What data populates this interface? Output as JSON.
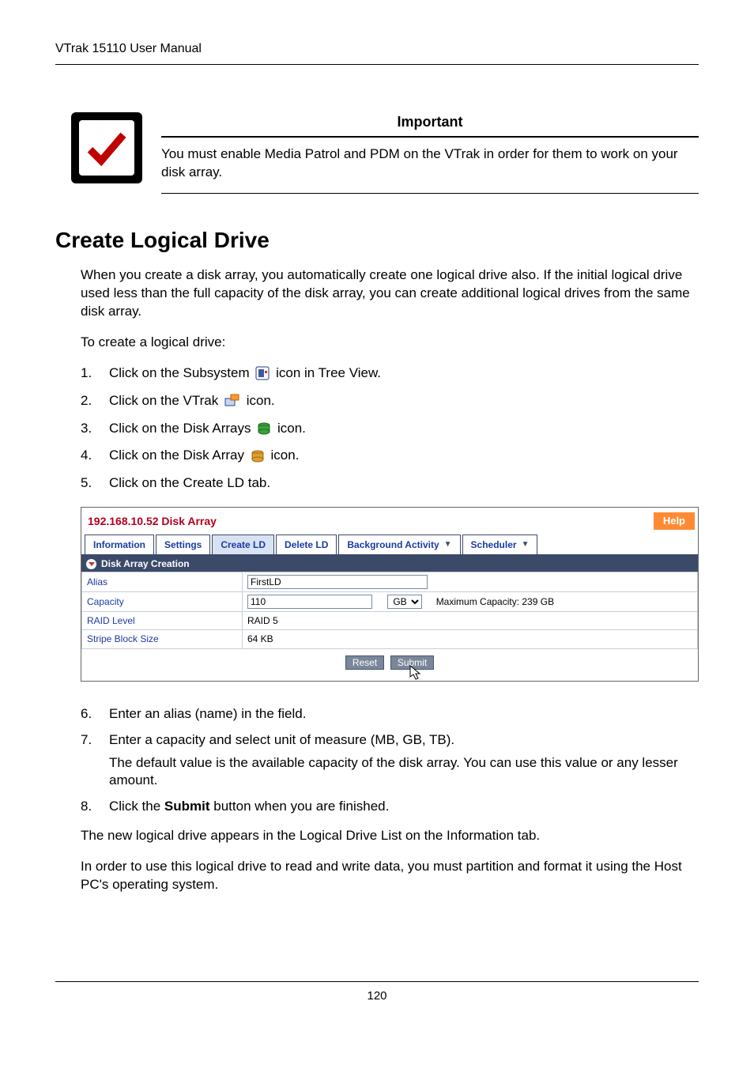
{
  "header": {
    "title": "VTrak 15110 User Manual"
  },
  "important": {
    "heading": "Important",
    "text": "You must enable Media Patrol and PDM on the VTrak in order for them to work on your disk array."
  },
  "section_title": "Create Logical Drive",
  "intro1": "When you create a disk array, you automatically create one logical drive also. If the initial logical drive used less than the full capacity of the disk array, you can create additional logical drives from the same disk array.",
  "intro2": "To create a logical drive:",
  "steps_a": [
    {
      "num": "1.",
      "before": "Click on the Subsystem ",
      "after": " icon in Tree View.",
      "icon": "subsystem"
    },
    {
      "num": "2.",
      "before": "Click on the VTrak ",
      "after": " icon.",
      "icon": "vtrak"
    },
    {
      "num": "3.",
      "before": "Click on the Disk Arrays ",
      "after": " icon.",
      "icon": "disk-arrays"
    },
    {
      "num": "4.",
      "before": "Click on the Disk Array ",
      "after": " icon.",
      "icon": "disk-array"
    },
    {
      "num": "5.",
      "before": "Click on the Create LD tab.",
      "after": "",
      "icon": ""
    }
  ],
  "ui": {
    "title": "192.168.10.52 Disk Array",
    "help": "Help",
    "tabs": {
      "information": "Information",
      "settings": "Settings",
      "create_ld": "Create LD",
      "delete_ld": "Delete LD",
      "background": "Background Activity",
      "scheduler": "Scheduler"
    },
    "subheader": "Disk Array Creation",
    "form": {
      "alias_label": "Alias",
      "alias_value": "FirstLD",
      "capacity_label": "Capacity",
      "capacity_value": "110",
      "capacity_unit": "GB",
      "capacity_max": "Maximum Capacity: 239 GB",
      "raid_label": "RAID Level",
      "raid_value": "RAID 5",
      "stripe_label": "Stripe Block Size",
      "stripe_value": "64 KB"
    },
    "buttons": {
      "reset": "Reset",
      "submit": "Submit"
    }
  },
  "steps_b": [
    {
      "num": "6.",
      "text": "Enter an alias (name) in the field."
    },
    {
      "num": "7.",
      "text": "Enter a capacity and select unit of measure (MB, GB, TB).",
      "sub": "The default value is the available capacity of the disk array. You can use this value or any lesser amount."
    },
    {
      "num": "8.",
      "text_before": "Click the ",
      "bold": "Submit",
      "text_after": " button when you are finished."
    }
  ],
  "tail1": "The new logical drive appears in the Logical Drive List on the Information tab.",
  "tail2": "In order to use this logical drive to read and write data, you must partition and format it using the Host PC's operating system.",
  "footer": {
    "page": "120"
  }
}
